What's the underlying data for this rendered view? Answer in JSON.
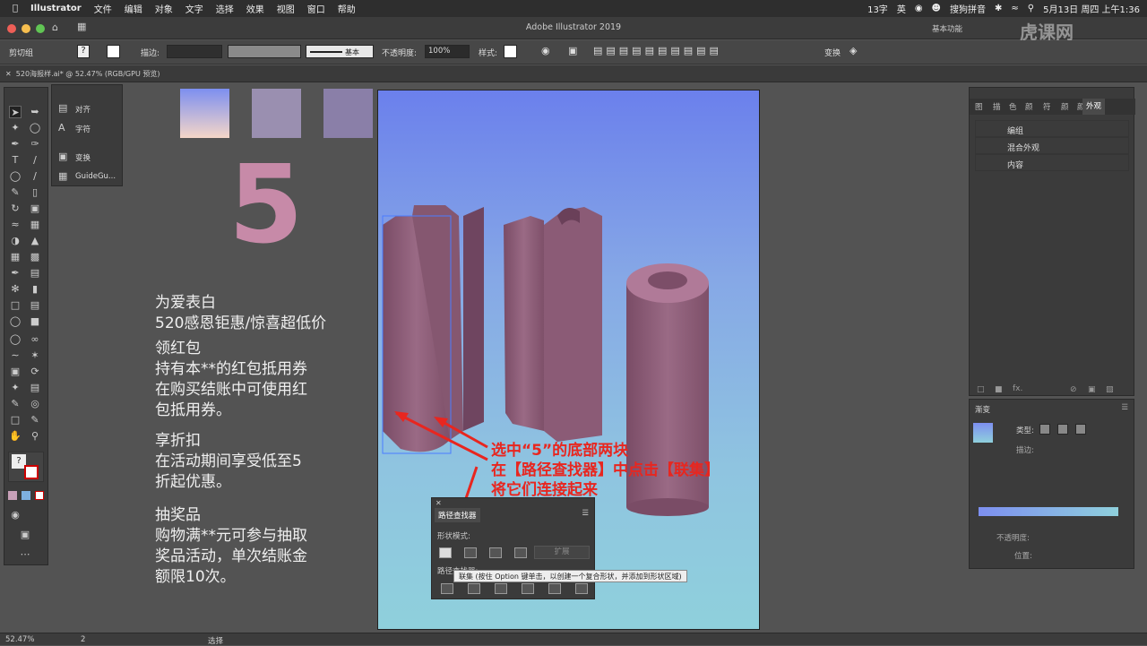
{
  "menubar": {
    "apple": "",
    "app": "Illustrator",
    "items": [
      "文件",
      "编辑",
      "对象",
      "文字",
      "选择",
      "效果",
      "视图",
      "窗口",
      "帮助"
    ],
    "right": [
      "13字",
      "英",
      "搜狗拼音",
      "5月13日 周四 上午1:36"
    ]
  },
  "titlebar": {
    "title": "Adobe Illustrator 2019",
    "workspace": "基本功能"
  },
  "control": {
    "selection": "剪切组",
    "stroke_label": "描边:",
    "stroke_style": "基本",
    "opacity_label": "不透明度:",
    "opacity_value": "100%",
    "style_label": "样式:",
    "transform": "变换"
  },
  "document_tab": "520海报样.ai* @ 52.47% (RGB/GPU 预览)",
  "floating_panel": {
    "items": [
      "对齐",
      "字符",
      "变换",
      "GuideGu..."
    ]
  },
  "artwork": {
    "digit": "5",
    "paragraphs": [
      [
        "为爱表白",
        "520感恩钜惠/惊喜超低价"
      ],
      [
        "领红包",
        "持有本**的红包抵用券",
        "在购买结账中可使用红",
        "包抵用券。"
      ],
      [
        "享折扣",
        "在活动期间享受低至5",
        "折起优惠。"
      ],
      [
        "抽奖品",
        "购物满**元可参与抽取",
        "奖品活动，单次结账金",
        "额限10次。"
      ]
    ]
  },
  "appearance_panel": {
    "tabs": [
      "图",
      "描",
      "色",
      "颜",
      "符",
      "颜",
      "颜",
      "外观"
    ],
    "active_tab": "外观",
    "rows": [
      "编组",
      "混合外观",
      "内容"
    ]
  },
  "gradient_panel": {
    "title": "渐变",
    "type_label": "类型:",
    "stroke_label": "描边:",
    "opacity_label": "不透明度:",
    "position_label": "位置:"
  },
  "pathfinder": {
    "title": "路径查找器",
    "shape_modes": "形状模式:",
    "expand": "扩展",
    "pathfinders": "路径查找器:",
    "tooltip": "联集 (按住 Option 键单击，以创建一个复合形状，并添加到形状区域)"
  },
  "annotation": {
    "lines": [
      "选中“5”的底部两块",
      "在【路径查找器】中点击【联集】",
      "将它们连接起来"
    ]
  },
  "status": {
    "zoom": "52.47%",
    "page": "2",
    "tool": "选择"
  },
  "watermark": "虎课网",
  "colors": {
    "accent_red": "#e8261f",
    "letter_pink": "#8e5e7a",
    "swatch1_top": "#7d8ff0",
    "swatch1_bottom": "#f5d6c8",
    "swatch2": "#9a8fb0",
    "swatch3": "#8a7fa8"
  }
}
